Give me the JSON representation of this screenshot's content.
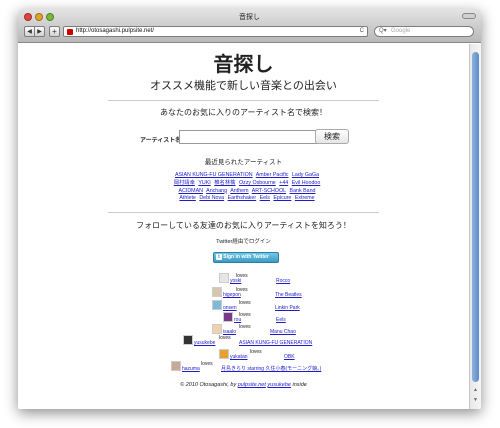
{
  "window": {
    "title": "音探し"
  },
  "toolbar": {
    "back": "◀",
    "forward": "▶",
    "add": "+",
    "url": "http://otosagashi.pulpsite.net/",
    "reload": "C",
    "search_placeholder": "Google"
  },
  "page": {
    "title": "音探し",
    "tagline": "オススメ機能で新しい音楽との出会い",
    "search_heading": "あなたのお気に入りのアーティスト名で検索！",
    "artist_label": "アーティスト名",
    "artist_value": "",
    "search_button": "検索",
    "recent_heading": "最近見られたアーティスト",
    "recent_artists": [
      "ASIAN KUNG-FU GENERATION",
      "Amber Pacific",
      "Lady GaGa",
      "岡村靖幸",
      "YUKI",
      "椎名林檎",
      "Ozzy Osbourne",
      "+44",
      "Evil Hoodoo",
      "ACIDMAN",
      "Anchang",
      "Anthem",
      "ART-SCHOOL",
      "Bank Band",
      "Athlete",
      "Debi Nova",
      "Earthshaker",
      "Eels",
      "Epicure",
      "Extreme"
    ],
    "friends_heading": "フォローしている友達のお気に入りアーティストを知ろう！",
    "twitter_note": "Twitter経由でログイン",
    "twitter_button": "Sign in with Twitter",
    "loves_word": "loves",
    "friends": [
      {
        "user": "yoski",
        "artist": "Rocco"
      },
      {
        "user": "higepon",
        "artist": "The Beatles"
      },
      {
        "user": "onsen",
        "artist": "Linkin Park"
      },
      {
        "user": "rou",
        "artist": "Eels"
      },
      {
        "user": "isaalo",
        "artist": "Manu Chao"
      },
      {
        "user": "yusukebe",
        "artist": "ASIAN KUNG-FU GENERATION"
      },
      {
        "user": "yukatan",
        "artist": "OBK"
      },
      {
        "user": "hazuma",
        "artist": "月島きらり starring 久住小春(モーニング娘。)"
      }
    ],
    "footer_prefix": "© 2010 Otosagashi, by",
    "footer_link1": "pulpsite.net",
    "footer_link2": "yusukebe",
    "footer_suffix": "inside"
  }
}
